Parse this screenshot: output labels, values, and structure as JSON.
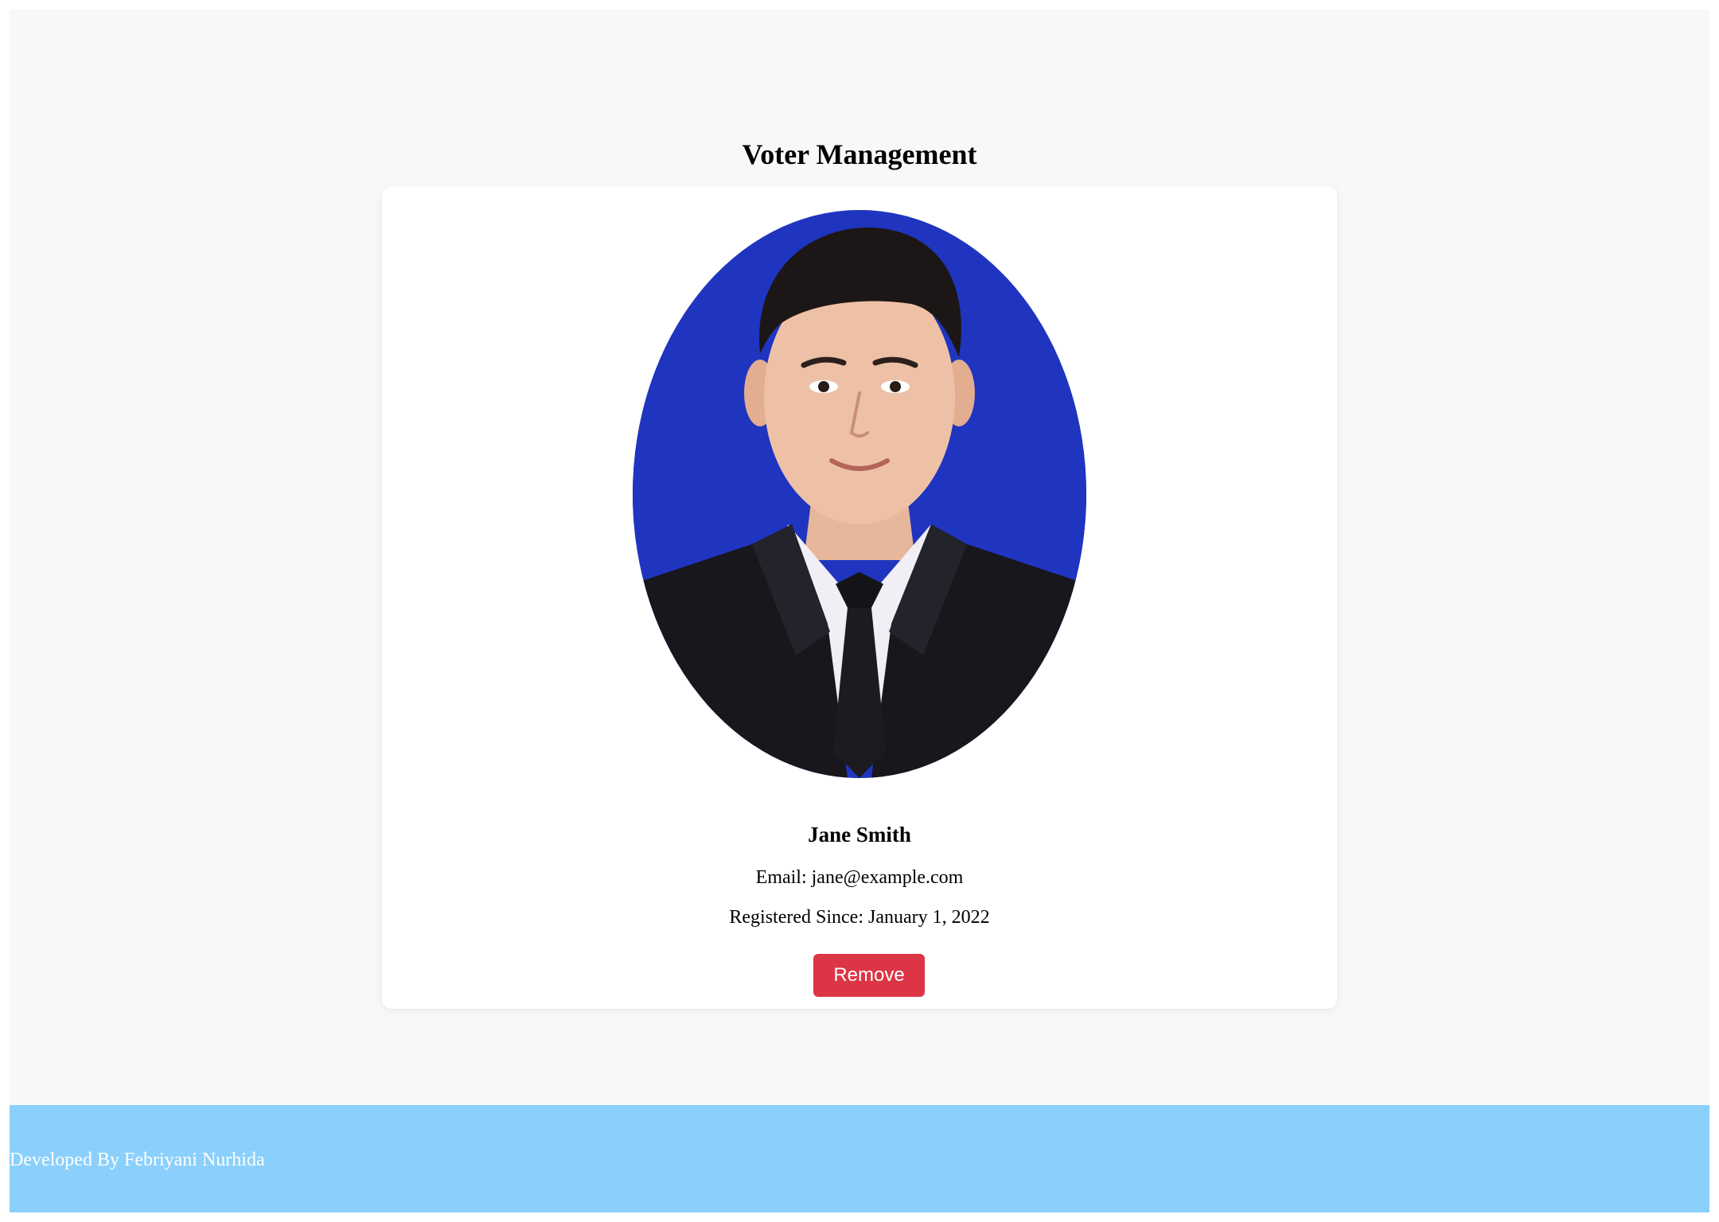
{
  "page": {
    "title": "Voter Management"
  },
  "voter": {
    "name": "Jane Smith",
    "email_label": "Email:",
    "email": "jane@example.com",
    "email_line": "Email: jane@example.com",
    "registered_label": "Registered Since:",
    "registered_date": "January 1, 2022",
    "registered_line": "Registered Since: January 1, 2022",
    "photo_icon": "voter-portrait-photo"
  },
  "actions": {
    "remove_label": "Remove"
  },
  "footer": {
    "text": "Developed By Febriyani Nurhida"
  },
  "colors": {
    "page_background": "#f7f8fa",
    "card_background": "#ffffff",
    "remove_button": "#dc3545",
    "footer_background": "#8bd0fc",
    "photo_background": "#1f35c0"
  }
}
